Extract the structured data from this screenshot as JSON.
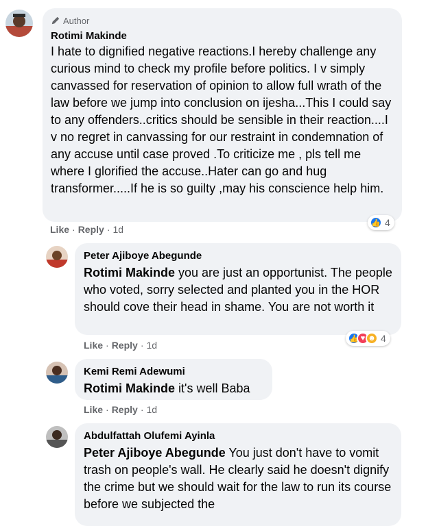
{
  "comments": [
    {
      "author_badge": "Author",
      "name": "Rotimi Makinde",
      "text": "I hate to dignified negative reactions.I hereby challenge any curious mind to check my profile before politics. I v simply canvassed for reservation of opinion to allow full wrath of the law before we jump into conclusion on ijesha...This I could say to any offenders..critics should be sensible in their reaction....I v no regret in canvassing for our restraint in condemnation of any accuse until case proved .To criticize me , pls tell me where I glorified the accuse..Hater can go and hug transformer.....If he is so guilty ,may his conscience help him.",
      "like": "Like",
      "reply": "Reply",
      "time": "1d",
      "reaction_count": "4",
      "reaction_icons": [
        "like"
      ]
    },
    {
      "name": "Peter Ajiboye Abegunde",
      "mention": "Rotimi Makinde",
      "text": " you are just an opportunist. The people who voted, sorry selected and planted you in the HOR should cove their head in shame. You are not worth it",
      "like": "Like",
      "reply": "Reply",
      "time": "1d",
      "reaction_count": "4",
      "reaction_icons": [
        "like",
        "love",
        "haha"
      ]
    },
    {
      "name": "Kemi Remi Adewumi",
      "mention": "Rotimi Makinde",
      "text": " it's well Baba",
      "like": "Like",
      "reply": "Reply",
      "time": "1d"
    },
    {
      "name": "Abdulfattah Olufemi Ayinla",
      "mention": "Peter Ajiboye Abegunde",
      "text": " You just don't have to vomit trash on people's wall. He clearly said he doesn't dignify the crime but we should wait for the law to run its course before we subjected the"
    }
  ],
  "separator": "·",
  "colors": {
    "bubble": "#f0f2f5",
    "meta": "#65676b",
    "like_blue": "#1877f2",
    "love_red": "#f33e58",
    "haha_yellow": "#f7b125"
  }
}
